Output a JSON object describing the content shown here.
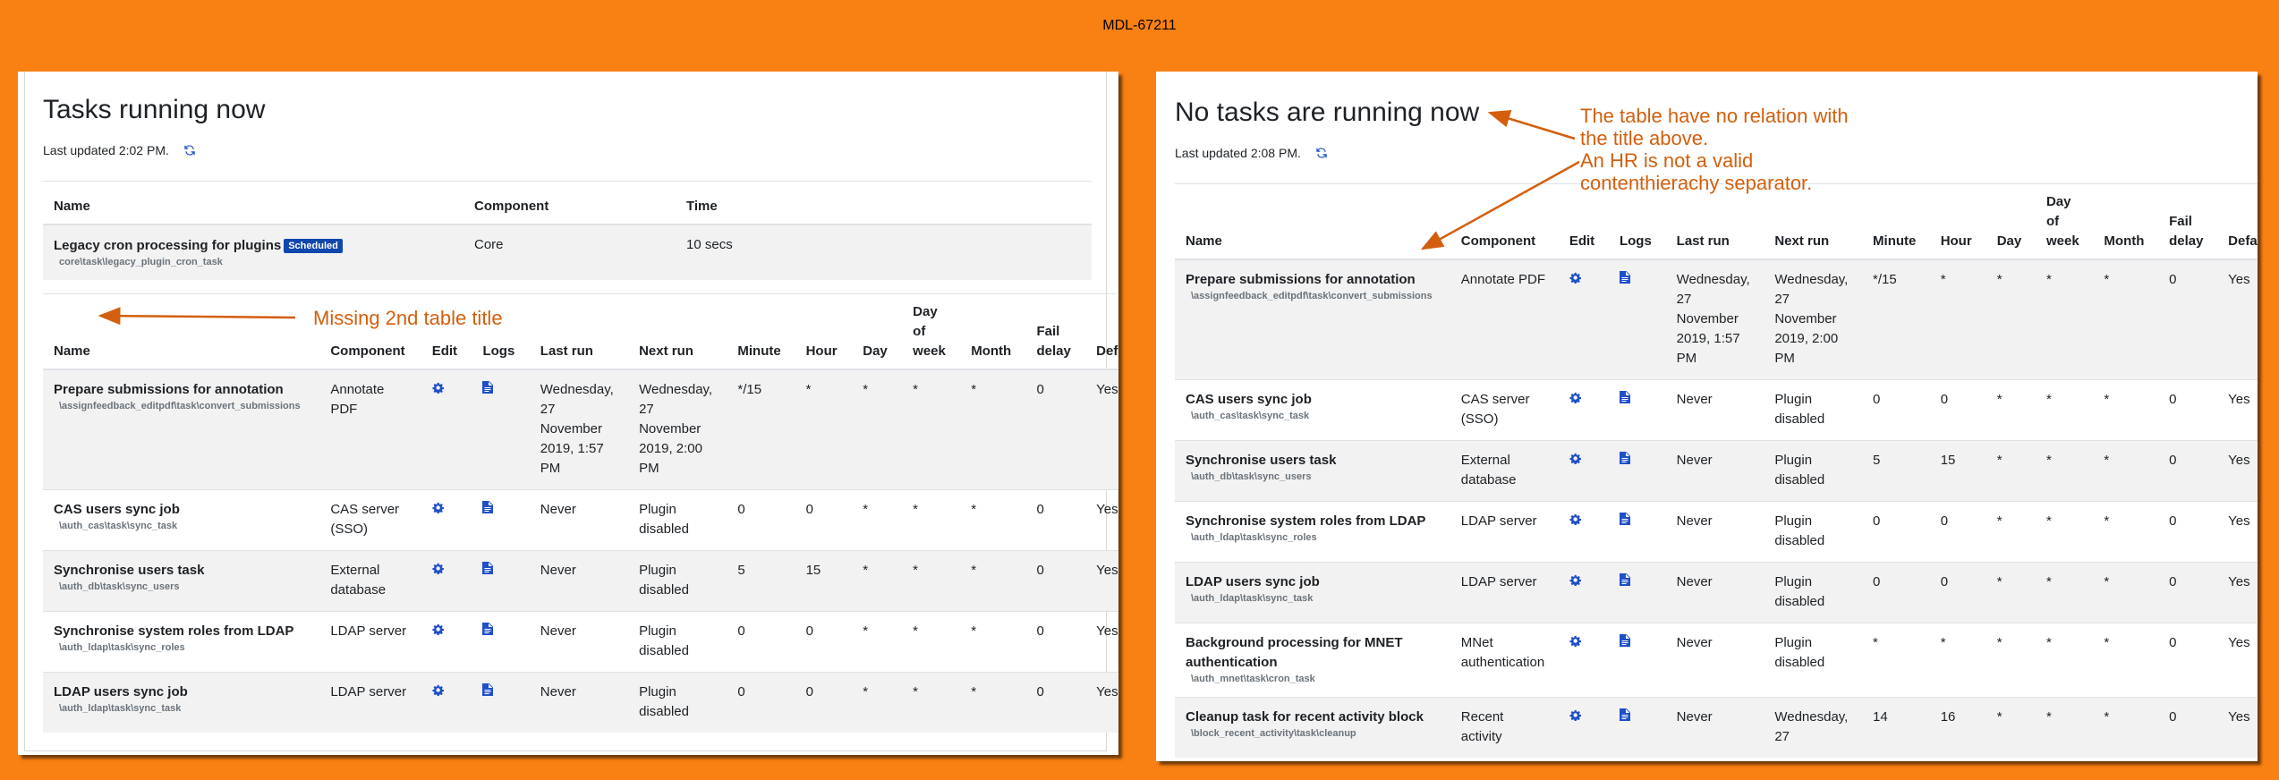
{
  "page_caption": "MDL-67211",
  "left": {
    "title": "Tasks running now",
    "last_updated": "Last updated 2:02 PM.",
    "running_table": {
      "columns": [
        "Name",
        "Component",
        "Time"
      ],
      "rows": [
        {
          "name": "Legacy cron processing for plugins",
          "badge": "Scheduled",
          "class": "core\\task\\legacy_plugin_cron_task",
          "component": "Core",
          "time": "10 secs"
        }
      ]
    },
    "annotation": "Missing 2nd table title",
    "scheduled_table": {
      "columns": [
        "Name",
        "Component",
        "Edit",
        "Logs",
        "Last run",
        "Next run",
        "Minute",
        "Hour",
        "Day",
        "Day of week",
        "Month",
        "Fail delay",
        "Default"
      ],
      "rows": [
        {
          "name": "Prepare submissions for annotation",
          "class": "\\assignfeedback_editpdf\\task\\convert_submissions",
          "component": "Annotate PDF",
          "last_run": "Wednesday, 27 November 2019, 1:57 PM",
          "next_run": "Wednesday, 27 November 2019, 2:00 PM",
          "minute": "*/15",
          "hour": "*",
          "day": "*",
          "dow": "*",
          "month": "*",
          "fail_delay": "0",
          "default": "Yes"
        },
        {
          "name": "CAS users sync job",
          "class": "\\auth_cas\\task\\sync_task",
          "component": "CAS server (SSO)",
          "last_run": "Never",
          "next_run": "Plugin disabled",
          "minute": "0",
          "hour": "0",
          "day": "*",
          "dow": "*",
          "month": "*",
          "fail_delay": "0",
          "default": "Yes"
        },
        {
          "name": "Synchronise users task",
          "class": "\\auth_db\\task\\sync_users",
          "component": "External database",
          "last_run": "Never",
          "next_run": "Plugin disabled",
          "minute": "5",
          "hour": "15",
          "day": "*",
          "dow": "*",
          "month": "*",
          "fail_delay": "0",
          "default": "Yes"
        },
        {
          "name": "Synchronise system roles from LDAP",
          "class": "\\auth_ldap\\task\\sync_roles",
          "component": "LDAP server",
          "last_run": "Never",
          "next_run": "Plugin disabled",
          "minute": "0",
          "hour": "0",
          "day": "*",
          "dow": "*",
          "month": "*",
          "fail_delay": "0",
          "default": "Yes"
        },
        {
          "name": "LDAP users sync job",
          "class": "\\auth_ldap\\task\\sync_task",
          "component": "LDAP server",
          "last_run": "Never",
          "next_run": "Plugin disabled",
          "minute": "0",
          "hour": "0",
          "day": "*",
          "dow": "*",
          "month": "*",
          "fail_delay": "0",
          "default": "Yes"
        }
      ]
    }
  },
  "right": {
    "title": "No tasks are running now",
    "last_updated": "Last updated 2:08 PM.",
    "annotation": "The table have no relation with\nthe title above.\nAn HR is not a valid\ncontenthierachy separator.",
    "scheduled_table": {
      "columns": [
        "Name",
        "Component",
        "Edit",
        "Logs",
        "Last run",
        "Next run",
        "Minute",
        "Hour",
        "Day",
        "Day of week",
        "Month",
        "Fail delay",
        "Default"
      ],
      "rows": [
        {
          "name": "Prepare submissions for annotation",
          "class": "\\assignfeedback_editpdf\\task\\convert_submissions",
          "component": "Annotate PDF",
          "last_run": "Wednesday, 27 November 2019, 1:57 PM",
          "next_run": "Wednesday, 27 November 2019, 2:00 PM",
          "minute": "*/15",
          "hour": "*",
          "day": "*",
          "dow": "*",
          "month": "*",
          "fail_delay": "0",
          "default": "Yes"
        },
        {
          "name": "CAS users sync job",
          "class": "\\auth_cas\\task\\sync_task",
          "component": "CAS server (SSO)",
          "last_run": "Never",
          "next_run": "Plugin disabled",
          "minute": "0",
          "hour": "0",
          "day": "*",
          "dow": "*",
          "month": "*",
          "fail_delay": "0",
          "default": "Yes"
        },
        {
          "name": "Synchronise users task",
          "class": "\\auth_db\\task\\sync_users",
          "component": "External database",
          "last_run": "Never",
          "next_run": "Plugin disabled",
          "minute": "5",
          "hour": "15",
          "day": "*",
          "dow": "*",
          "month": "*",
          "fail_delay": "0",
          "default": "Yes"
        },
        {
          "name": "Synchronise system roles from LDAP",
          "class": "\\auth_ldap\\task\\sync_roles",
          "component": "LDAP server",
          "last_run": "Never",
          "next_run": "Plugin disabled",
          "minute": "0",
          "hour": "0",
          "day": "*",
          "dow": "*",
          "month": "*",
          "fail_delay": "0",
          "default": "Yes"
        },
        {
          "name": "LDAP users sync job",
          "class": "\\auth_ldap\\task\\sync_task",
          "component": "LDAP server",
          "last_run": "Never",
          "next_run": "Plugin disabled",
          "minute": "0",
          "hour": "0",
          "day": "*",
          "dow": "*",
          "month": "*",
          "fail_delay": "0",
          "default": "Yes"
        },
        {
          "name": "Background processing for MNET authentication",
          "class": "\\auth_mnet\\task\\cron_task",
          "component": "MNet authentication",
          "last_run": "Never",
          "next_run": "Plugin disabled",
          "minute": "*",
          "hour": "*",
          "day": "*",
          "dow": "*",
          "month": "*",
          "fail_delay": "0",
          "default": "Yes"
        },
        {
          "name": "Cleanup task for recent activity block",
          "class": "\\block_recent_activity\\task\\cleanup",
          "component": "Recent activity",
          "last_run": "Never",
          "next_run": "Wednesday, 27",
          "minute": "14",
          "hour": "16",
          "day": "*",
          "dow": "*",
          "month": "*",
          "fail_delay": "0",
          "default": "Yes"
        }
      ]
    }
  },
  "colors": {
    "background": "#f98012",
    "annotation": "#d35f0e",
    "icon": "#1f4fc9",
    "badge": "#0f47ad"
  },
  "icons": {
    "edit": "gear-icon",
    "logs": "file-icon",
    "refresh": "refresh-icon"
  }
}
